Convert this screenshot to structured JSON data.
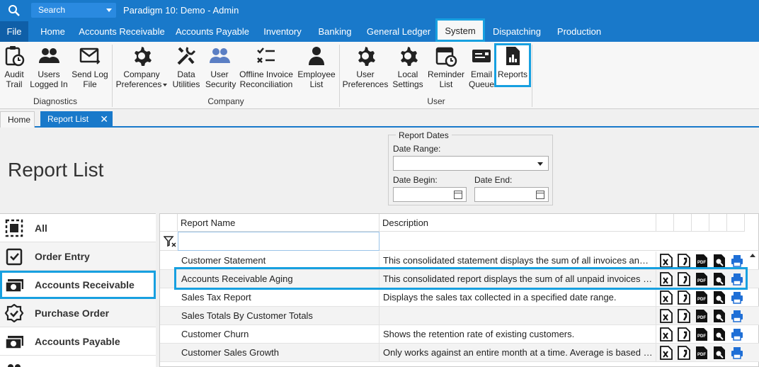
{
  "titlebar": {
    "search_label": "Search",
    "app_title": "Paradigm 10: Demo - Admin"
  },
  "menu": {
    "items": [
      {
        "label": "File"
      },
      {
        "label": "Home"
      },
      {
        "label": "Accounts Receivable"
      },
      {
        "label": "Accounts Payable"
      },
      {
        "label": "Inventory"
      },
      {
        "label": "Banking"
      },
      {
        "label": "General Ledger"
      },
      {
        "label": "System",
        "active": true
      },
      {
        "label": "Dispatching"
      },
      {
        "label": "Production"
      }
    ]
  },
  "ribbon": {
    "buttons": [
      {
        "label": "Audit\nTrail",
        "icon": "clipboard-clock-icon"
      },
      {
        "label": "Users\nLogged In",
        "icon": "users-icon"
      },
      {
        "label": "Send Log\nFile",
        "icon": "envelope-arrow-icon"
      },
      {
        "label": "Company\nPreferences",
        "icon": "gear-icon"
      },
      {
        "label": "Data\nUtilities",
        "icon": "tools-icon"
      },
      {
        "label": "User\nSecurity",
        "icon": "user-security-icon"
      },
      {
        "label": "Offline Invoice\nReconciliation",
        "icon": "checklist-icon"
      },
      {
        "label": "Employee\nList",
        "icon": "person-icon"
      },
      {
        "label": "User\nPreferences",
        "icon": "gear-icon"
      },
      {
        "label": "Local\nSettings",
        "icon": "gear-icon"
      },
      {
        "label": "Reminder\nList",
        "icon": "calendar-clock-icon"
      },
      {
        "label": "Email\nQueue",
        "icon": "email-queue-icon"
      },
      {
        "label": "Reports",
        "icon": "report-chart-icon",
        "highlighted": true
      }
    ],
    "groups": [
      {
        "label": "Diagnostics"
      },
      {
        "label": "Company"
      },
      {
        "label": "User"
      }
    ]
  },
  "doc_tabs": {
    "home": "Home",
    "active": "Report List",
    "close": "✕"
  },
  "page": {
    "title": "Report List"
  },
  "report_dates": {
    "legend": "Report Dates",
    "date_range_label": "Date Range:",
    "date_range_value": "",
    "date_begin_label": "Date Begin:",
    "date_begin_value": "",
    "date_end_label": "Date End:",
    "date_end_value": ""
  },
  "categories": [
    {
      "label": "All",
      "icon": "dashed-square-icon"
    },
    {
      "label": "Order Entry",
      "icon": "checkbox-doc-icon"
    },
    {
      "label": "Accounts Receivable",
      "icon": "money-icon",
      "selected": true
    },
    {
      "label": "Purchase Order",
      "icon": "badge-check-icon"
    },
    {
      "label": "Accounts Payable",
      "icon": "money-icon"
    }
  ],
  "grid": {
    "columns": {
      "name": "Report Name",
      "description": "Description"
    },
    "filter_value": "",
    "rows": [
      {
        "name": "Customer Statement",
        "description": "This consolidated statement displays the sum of all invoices and payments for each customer."
      },
      {
        "name": "Accounts Receivable Aging",
        "description": "This consolidated report displays the sum of all unpaid invoices by aging period.",
        "highlighted": true
      },
      {
        "name": "Sales Tax Report",
        "description": "Displays the sales tax collected in a specified date range."
      },
      {
        "name": "Sales Totals By Customer Totals",
        "description": ""
      },
      {
        "name": "Customer Churn",
        "description": "Shows the retention rate of existing customers."
      },
      {
        "name": "Customer Sales Growth",
        "description": "Only works against an entire month at a time. Average is based on monthly sales."
      }
    ],
    "row_actions": [
      "excel-icon",
      "csv-icon",
      "pdf-icon",
      "preview-icon",
      "print-icon"
    ],
    "pdf_text": "PDF"
  },
  "colors": {
    "brand": "#1979ca",
    "highlight": "#17a0e0",
    "print_blue": "#1f6fd6"
  }
}
